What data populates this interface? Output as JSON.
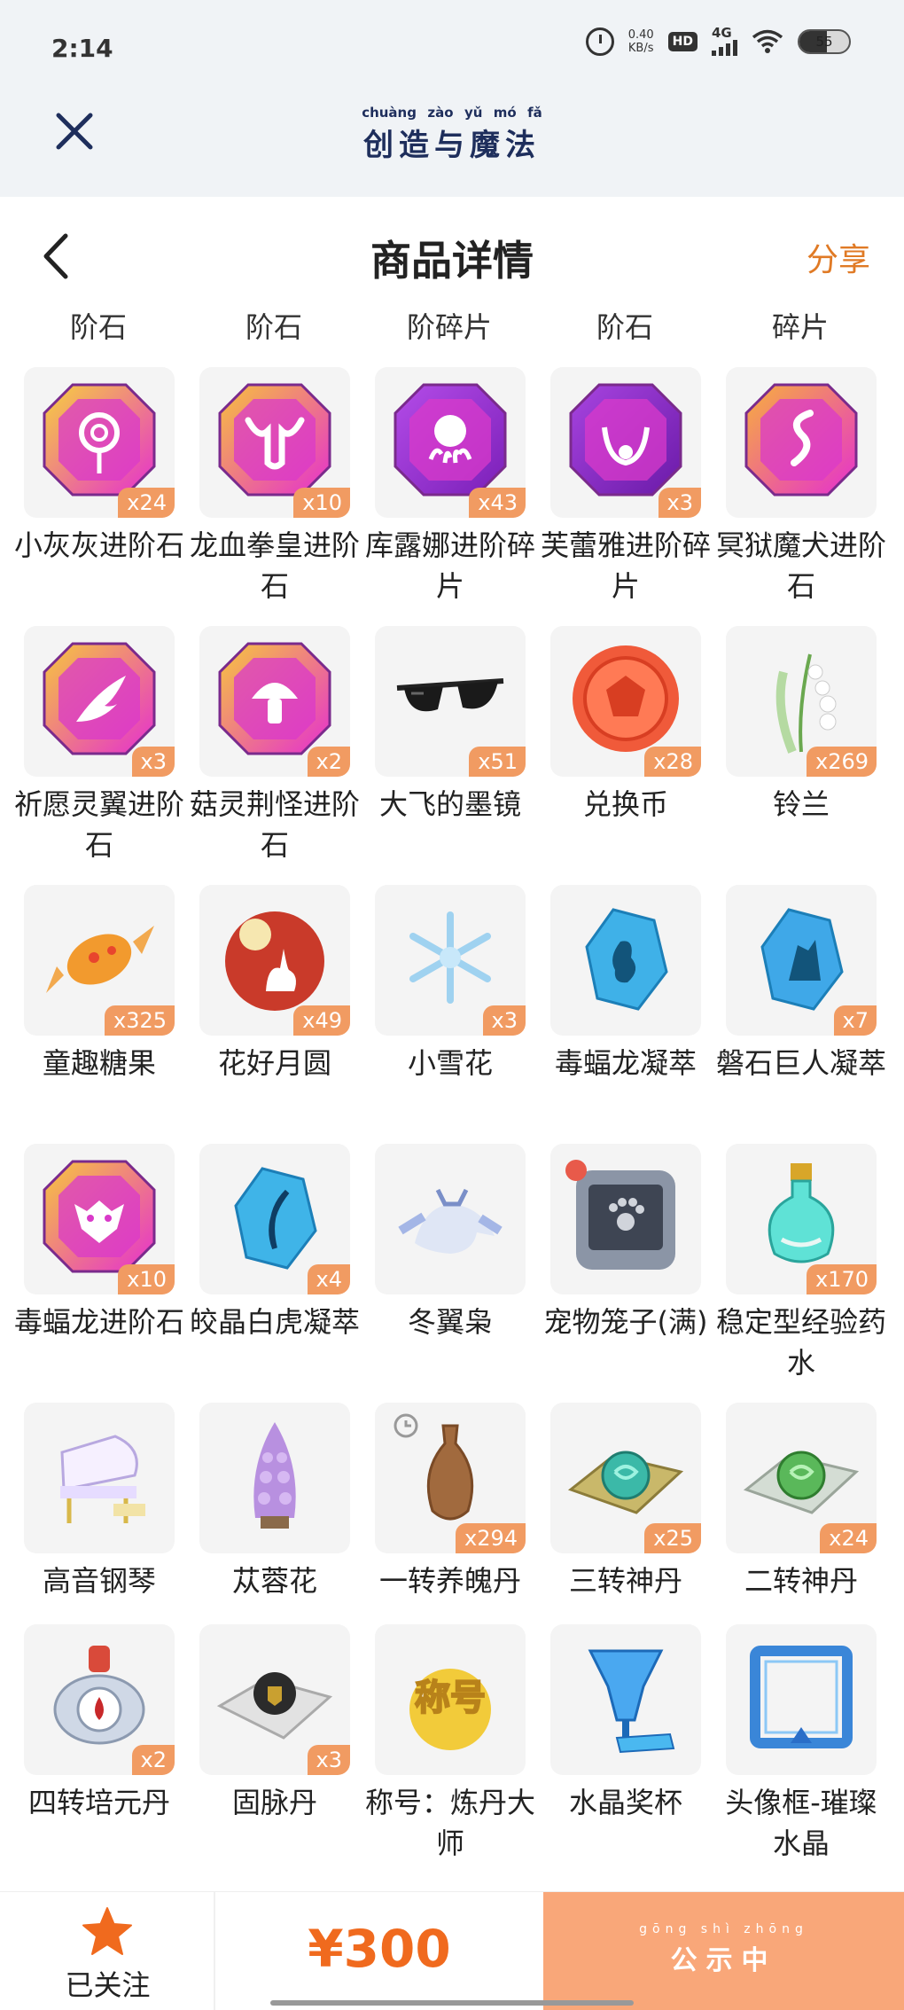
{
  "status_bar": {
    "time": "2:14",
    "net_speed_value": "0.40",
    "net_speed_unit": "KB/s",
    "hd_label": "HD",
    "signal_label": "4G",
    "battery": "55",
    "icons": [
      "alarm-icon",
      "hd-icon",
      "signal-icon",
      "wifi-icon",
      "battery-icon"
    ]
  },
  "app_header": {
    "close_icon": "close-icon",
    "logo_pinyin": [
      "chuàng",
      "zào",
      "yǔ",
      "mó",
      "fǎ"
    ],
    "logo_text": "创造与魔法"
  },
  "nav": {
    "back_icon": "chevron-left-icon",
    "title": "商品详情",
    "share_label": "分享"
  },
  "partial_row_labels": [
    "阶石",
    "阶石",
    "阶碎片",
    "阶石",
    "碎片"
  ],
  "items": [
    {
      "name": "小灰灰进阶石",
      "qty": "x24",
      "icon": "gem-lollipop-icon"
    },
    {
      "name": "龙血拳皇进阶石",
      "qty": "x10",
      "icon": "gem-bull-icon"
    },
    {
      "name": "库露娜进阶碎片",
      "qty": "x43",
      "icon": "gem-octopus-icon"
    },
    {
      "name": "芙蕾雅进阶碎片",
      "qty": "x3",
      "icon": "gem-crest-icon"
    },
    {
      "name": "冥狱魔犬进阶石",
      "qty": "",
      "icon": "gem-serpent-icon"
    },
    {
      "name": "祈愿灵翼进阶石",
      "qty": "x3",
      "icon": "gem-wing-icon"
    },
    {
      "name": "菇灵荆怪进阶石",
      "qty": "x2",
      "icon": "gem-mushroom-icon"
    },
    {
      "name": "大飞的墨镜",
      "qty": "x51",
      "icon": "sunglasses-icon"
    },
    {
      "name": "兑换币",
      "qty": "x28",
      "icon": "coin-icon"
    },
    {
      "name": "铃兰",
      "qty": "x269",
      "icon": "lily-of-valley-icon"
    },
    {
      "name": "童趣糖果",
      "qty": "x325",
      "icon": "candy-icon"
    },
    {
      "name": "花好月圆",
      "qty": "x49",
      "icon": "moon-rabbit-icon"
    },
    {
      "name": "小雪花",
      "qty": "x3",
      "icon": "snowflake-icon"
    },
    {
      "name": "毒蝠龙凝萃",
      "qty": "",
      "icon": "crystal-bat-icon"
    },
    {
      "name": "磐石巨人凝萃",
      "qty": "x7",
      "icon": "crystal-rock-icon"
    },
    {
      "name": "毒蝠龙进阶石",
      "qty": "x10",
      "icon": "gem-bat-icon"
    },
    {
      "name": "皎晶白虎凝萃",
      "qty": "x4",
      "icon": "crystal-fang-icon"
    },
    {
      "name": "冬翼枭",
      "qty": "",
      "icon": "winter-owl-icon"
    },
    {
      "name": "宠物笼子(满)",
      "qty": "",
      "icon": "pet-cage-icon"
    },
    {
      "name": "稳定型经验药水",
      "qty": "x170",
      "icon": "potion-icon"
    },
    {
      "name": "高音钢琴",
      "qty": "",
      "icon": "piano-icon"
    },
    {
      "name": "苁蓉花",
      "qty": "",
      "icon": "cistanche-flower-icon"
    },
    {
      "name": "一转养魄丹",
      "qty": "x294",
      "icon": "vase-icon"
    },
    {
      "name": "三转神丹",
      "qty": "x25",
      "icon": "pill-mat-icon"
    },
    {
      "name": "二转神丹",
      "qty": "x24",
      "icon": "pill-mat-green-icon"
    },
    {
      "name": "四转培元丹",
      "qty": "x2",
      "icon": "pill-device-icon"
    },
    {
      "name": "固脉丹",
      "qty": "x3",
      "icon": "pill-dark-icon"
    },
    {
      "name": "称号：炼丹大师",
      "qty": "",
      "icon": "title-badge-icon"
    },
    {
      "name": "水晶奖杯",
      "qty": "",
      "icon": "crystal-trophy-icon"
    },
    {
      "name": "头像框-璀璨水晶",
      "qty": "",
      "icon": "avatar-frame-icon"
    }
  ],
  "item_badges": {
    "title_badge_text": "称号"
  },
  "bottom_bar": {
    "follow_label": "已关注",
    "price": "¥300",
    "publicity_pinyin": "gōng shì zhōng",
    "publicity_label": "公示中"
  },
  "colors": {
    "accent_orange": "#e07a25",
    "price_orange": "#f06a1e",
    "publicity_button": "#f9a779",
    "qty_badge": "#f19b62",
    "header_bg": "#f0f3f6"
  }
}
